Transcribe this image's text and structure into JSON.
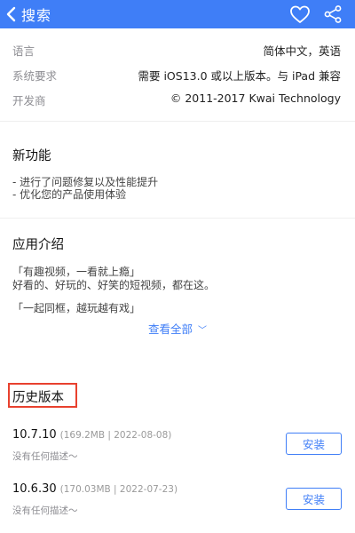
{
  "nav": {
    "back_label": "搜索",
    "icons": [
      "chevron-left-icon",
      "heart-icon",
      "share-icon"
    ]
  },
  "info": [
    {
      "key": "语言",
      "value": "简体中文，英语"
    },
    {
      "key": "系统要求",
      "value": "需要 iOS13.0 或以上版本。与 iPad 兼容"
    },
    {
      "key": "开发商",
      "value": "© 2011-2017 Kwai Technology"
    }
  ],
  "whats_new": {
    "title": "新功能",
    "lines": [
      "- 进行了问题修复以及性能提升",
      "- 优化您的产品使用体验"
    ]
  },
  "intro": {
    "title": "应用介绍",
    "lines": [
      "「有趣视频，一看就上瘾」",
      "好看的、好玩的、好笑的短视频，都在这。",
      "「一起同框，越玩越有戏」"
    ],
    "more_label": "查看全部",
    "more_chevron": "﹀"
  },
  "history": {
    "title": "历史版本",
    "versions": [
      {
        "version": "10.7.10",
        "meta": "(169.2MB | 2022-08-08)",
        "desc": "没有任何描述～",
        "button": "安装"
      },
      {
        "version": "10.6.30",
        "meta": "(170.03MB | 2022-07-23)",
        "desc": "没有任何描述～",
        "button": "安装"
      }
    ]
  },
  "colors": {
    "accent": "#3f7ef7",
    "highlight_box": "#e8412e"
  }
}
